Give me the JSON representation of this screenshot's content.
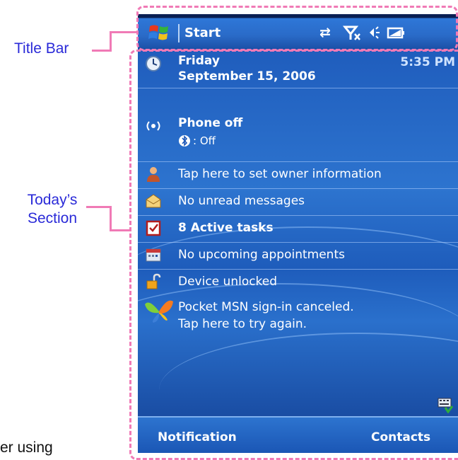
{
  "callouts": {
    "title_bar": "Title Bar",
    "todays_section": "Today’s Section",
    "cut_text": "er using"
  },
  "titlebar": {
    "start_label": "Start",
    "icons": [
      "connectivity-icon",
      "signal-off-icon",
      "volume-icon",
      "battery-icon"
    ]
  },
  "today": {
    "day": "Friday",
    "date": "September 15, 2006",
    "time": "5:35 PM",
    "phone_status": "Phone off",
    "bluetooth_status": ": Off",
    "owner_info": "Tap here to set owner information",
    "messages": "No unread messages",
    "tasks": "8 Active tasks",
    "appointments": "No upcoming appointments",
    "device_lock": "Device unlocked",
    "msn_line1": "Pocket MSN sign-in canceled.",
    "msn_line2": "Tap here to try again."
  },
  "softkeys": {
    "left": "Notification",
    "right": "Contacts"
  },
  "colors": {
    "callout_text": "#2a2ad8",
    "annotation": "#f07ab6",
    "screen_blue": "#2d74cf"
  }
}
